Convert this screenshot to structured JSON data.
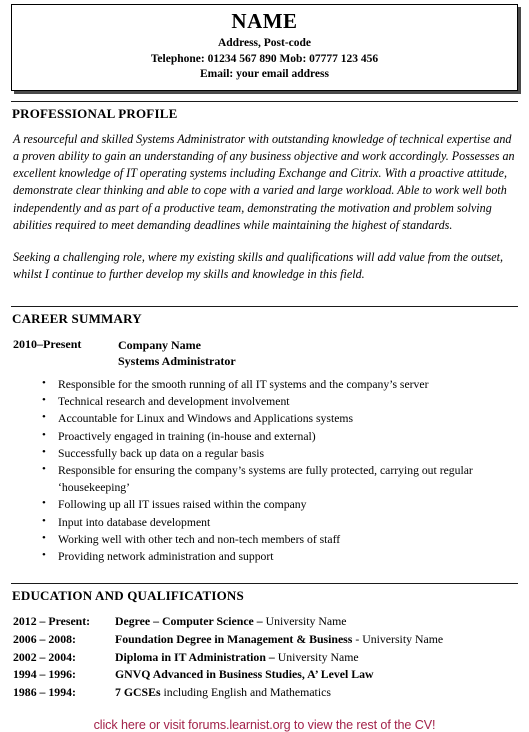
{
  "header": {
    "name": "NAME",
    "address": "Address, Post-code",
    "phone": "Telephone: 01234 567 890 Mob: 07777 123 456",
    "email": "Email: your email address"
  },
  "sections": {
    "profile": {
      "title": "PROFESSIONAL PROFILE",
      "paragraph1": "A resourceful and skilled Systems Administrator with outstanding knowledge of technical expertise and a proven ability to gain an understanding of any business objective and work accordingly.  Possesses an excellent knowledge of IT operating systems including Exchange and Citrix.  With a proactive attitude, demonstrate clear thinking and able to cope with a varied and large workload.  Able to work well both independently and as part of a productive team, demonstrating the motivation and problem solving abilities required to meet demanding deadlines while maintaining the highest of standards.",
      "paragraph2": "Seeking a challenging role, where my existing skills and qualifications will add value from the outset, whilst I continue to further develop my skills and knowledge in this field."
    },
    "career": {
      "title": "CAREER SUMMARY",
      "dates": "2010–Present",
      "company": "Company Name",
      "role": "Systems Administrator",
      "duties": [
        "Responsible for the smooth running of all IT systems and the company’s server",
        "Technical research and development involvement",
        "Accountable for Linux and Windows and Applications systems",
        "Proactively engaged in training (in-house and external)",
        "Successfully back up data on a regular basis",
        "Responsible for ensuring the company’s systems are fully protected, carrying out regular ‘housekeeping’",
        "Following up all IT issues raised within the company",
        "Input into database development",
        "Working well with other tech and non-tech members of staff",
        "Providing network administration and support"
      ]
    },
    "education": {
      "title": "EDUCATION AND QUALIFICATIONS",
      "rows": [
        {
          "date": "2012 – Present:",
          "bold": "Degree – Computer Science – ",
          "plain": "University Name"
        },
        {
          "date": "2006 – 2008:",
          "bold": "Foundation Degree in Management & Business ",
          "plain": "- University Name"
        },
        {
          "date": "2002 – 2004:",
          "bold": "Diploma in IT Administration – ",
          "plain": "University Name"
        },
        {
          "date": "1994 – 1996:",
          "bold": "GNVQ Advanced in Business Studies, A’ Level Law",
          "plain": ""
        },
        {
          "date": "1986 – 1994:",
          "bold": "7 GCSEs ",
          "plain": "including English and Mathematics"
        }
      ]
    }
  },
  "footer": {
    "link_text": "click here or visit forums.learnist.org to view the rest of the CV!",
    "link_color": "#A3224A"
  }
}
